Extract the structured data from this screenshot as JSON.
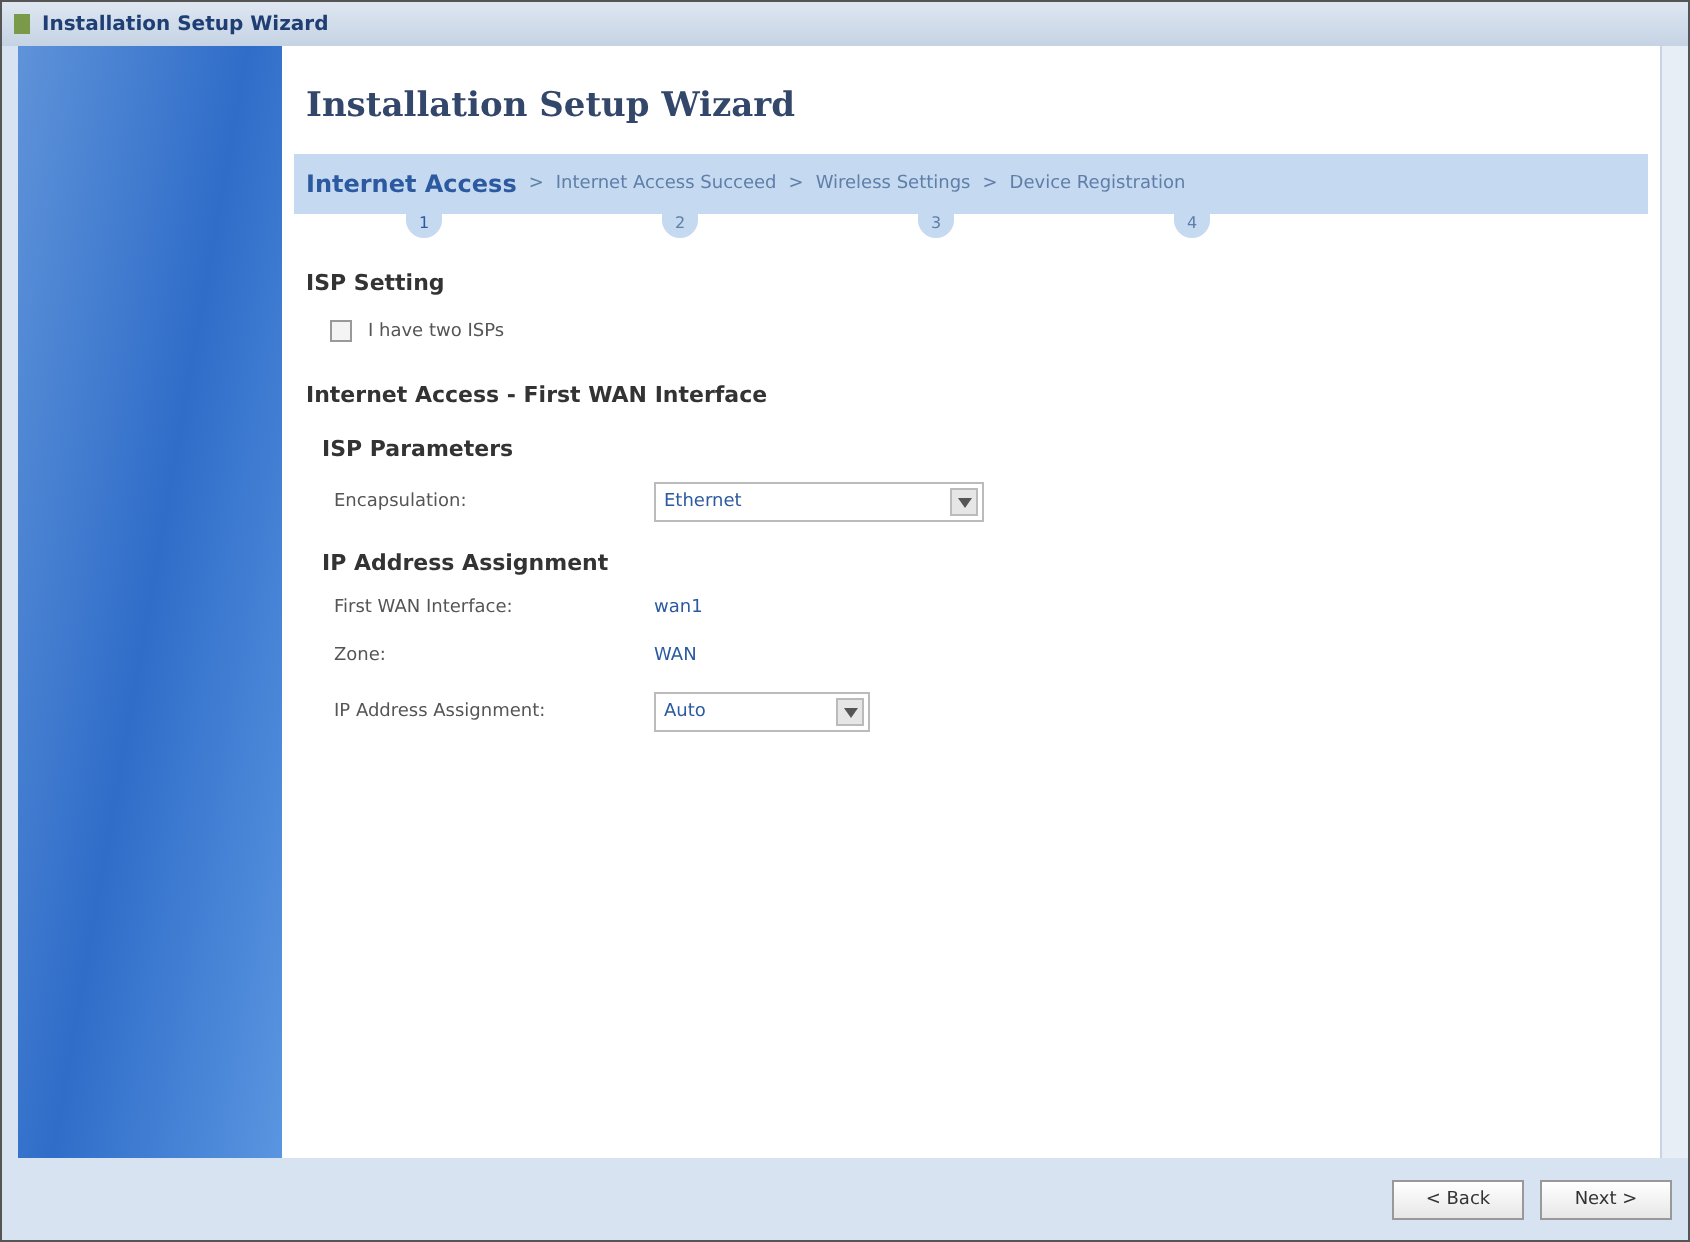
{
  "window": {
    "title": "Installation Setup Wizard"
  },
  "heading": "Installation Setup Wizard",
  "step_separator": ">",
  "steps": [
    {
      "label": "Internet Access",
      "number": "1",
      "selected": true
    },
    {
      "label": "Internet Access Succeed",
      "number": "2",
      "selected": false
    },
    {
      "label": "Wireless Settings",
      "number": "3",
      "selected": false
    },
    {
      "label": "Device Registration",
      "number": "4",
      "selected": false
    }
  ],
  "isp_setting": {
    "title": "ISP Setting",
    "checkbox": {
      "label": "I have two ISPs",
      "checked": false
    }
  },
  "section_title": "Internet Access - First WAN Interface",
  "groups": [
    {
      "title": "ISP Parameters",
      "rows": [
        {
          "kind": "select",
          "label": "Encapsulation:",
          "value": "Ethernet",
          "wide": true
        }
      ]
    },
    {
      "title": "IP Address Assignment",
      "rows": [
        {
          "kind": "text",
          "label": "First WAN Interface:",
          "value": "wan1"
        },
        {
          "kind": "text",
          "label": "Zone:",
          "value": "WAN"
        },
        {
          "kind": "select",
          "label": "IP Address Assignment:",
          "value": "Auto",
          "wide": false
        }
      ]
    }
  ],
  "buttons": [
    "< Back",
    "Next >"
  ]
}
